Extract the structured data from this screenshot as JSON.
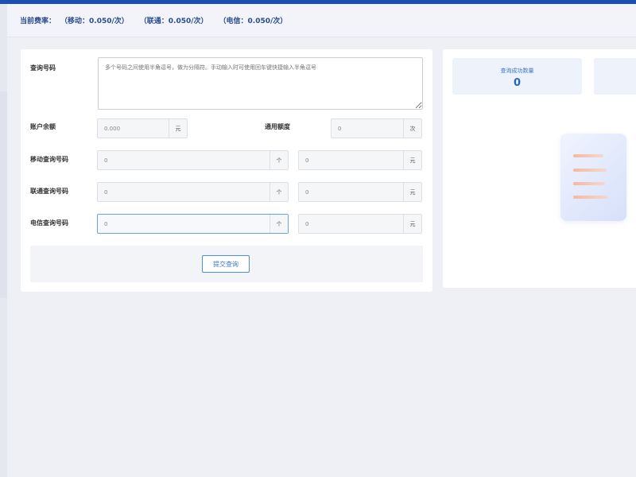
{
  "rate_bar": {
    "label": "当前费率：",
    "mobile": "（移动：0.050/次）",
    "unicom": "（联通：0.050/次）",
    "telecom": "（电信：0.050/次）"
  },
  "form": {
    "query_numbers_label": "查询号码",
    "query_numbers_placeholder": "多个号码之间使用半角逗号，做为分隔符。手动输入时可使用回车键快捷输入半角逗号",
    "balance_label": "账户余额",
    "balance_value": "0.000",
    "balance_unit": "元",
    "general_quota_label": "通用额度",
    "general_quota_value": "0",
    "general_quota_unit": "次",
    "mobile_label": "移动查询号码",
    "mobile_count": "0",
    "mobile_count_unit": "个",
    "mobile_cost": "0",
    "mobile_cost_unit": "元",
    "unicom_label": "联通查询号码",
    "unicom_count": "0",
    "unicom_count_unit": "个",
    "unicom_cost": "0",
    "unicom_cost_unit": "元",
    "telecom_label": "电信查询号码",
    "telecom_count": "0",
    "telecom_count_unit": "个",
    "telecom_cost": "0",
    "telecom_cost_unit": "元",
    "submit_label": "提交查询"
  },
  "stats": {
    "success_label": "查询成功数量",
    "success_value": "0"
  },
  "colors": {
    "accent": "#1b4fb8",
    "link": "#3b78c8"
  }
}
